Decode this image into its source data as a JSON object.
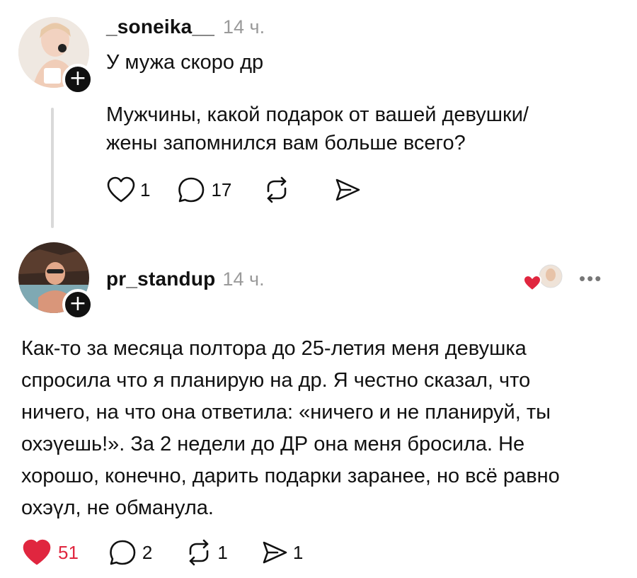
{
  "post": {
    "username": "_soneika__",
    "time": "14 ч.",
    "paragraph1": "У мужа скоро др",
    "paragraph2_line1": "Мужчины, какой подарок от вашей девушки/",
    "paragraph2_line2": "жены запомнился вам больше всего?",
    "likes": "1",
    "comments": "17",
    "reposts": "",
    "shares": ""
  },
  "reply": {
    "username": "pr_standup",
    "time": "14 ч.",
    "more": "•••",
    "lines": [
      "Как-то за месяца полтора до 25-летия меня девушка",
      "спросила что я планирую на др. Я честно сказал, что",
      "ничего, на что она ответила: «ничего и не планируй, ты",
      "охэүешь!». За 2 недели до ДР она меня бросила. Не",
      "хорошо, конечно, дарить подарки заранее, но всё равно",
      "охэүл, не обманула."
    ],
    "likes": "51",
    "comments": "2",
    "reposts": "1",
    "shares": "1",
    "liked": true
  },
  "colors": {
    "like_red": "#e0263f",
    "muted": "#9a9a9a",
    "text": "#111111"
  },
  "icons": [
    "heart-icon",
    "comment-icon",
    "repost-icon",
    "share-icon",
    "plus-icon",
    "more-icon"
  ]
}
